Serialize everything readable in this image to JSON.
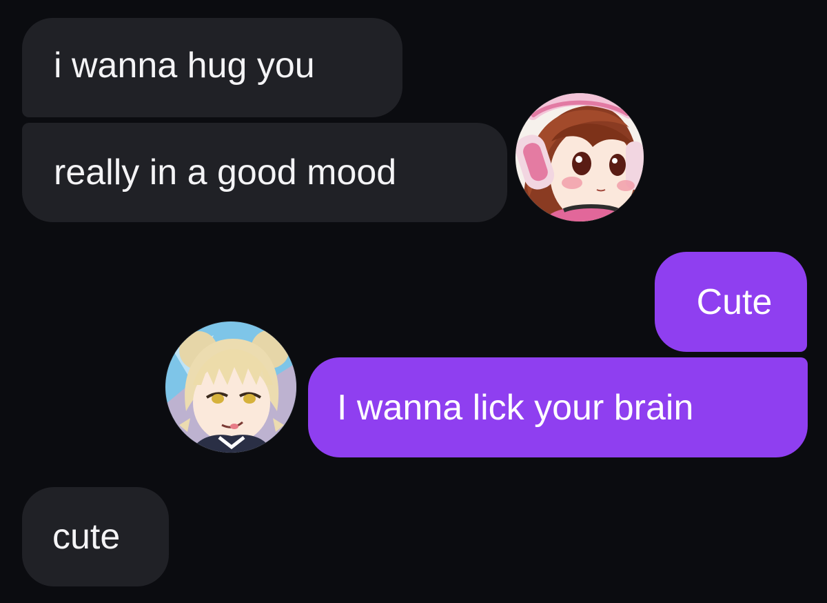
{
  "conversation": {
    "messages": [
      {
        "sender": "other",
        "text": "i wanna hug you"
      },
      {
        "sender": "other",
        "text": "really in a good mood"
      },
      {
        "sender": "me",
        "text": "Cute"
      },
      {
        "sender": "me",
        "text": "I wanna lick your brain"
      },
      {
        "sender": "other",
        "text": "cute"
      }
    ],
    "avatars": {
      "other": "avatar-girl-brown-hair-headphones",
      "me": "avatar-girl-blonde-buns"
    }
  },
  "colors": {
    "background": "#0b0c10",
    "incoming_bubble": "#202126",
    "outgoing_bubble": "#8f3ff0",
    "text": "#f4f4f6"
  }
}
